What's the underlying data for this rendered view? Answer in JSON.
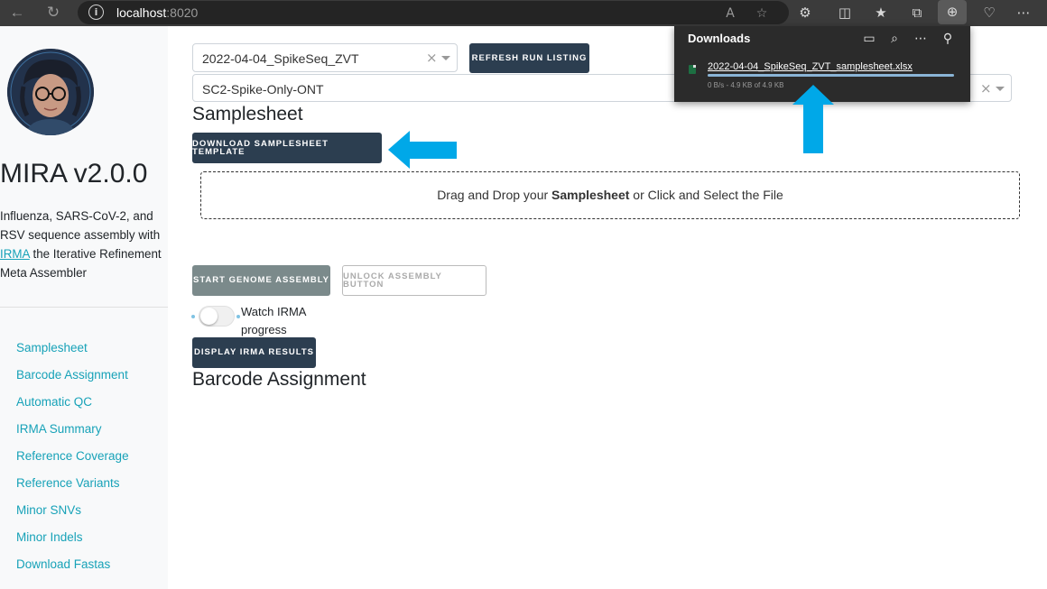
{
  "browser": {
    "url_host": "localhost",
    "url_port": ":8020"
  },
  "sidebar": {
    "app_title": "MIRA v2.0.0",
    "description_pre": "Influenza, SARS-CoV-2, and RSV sequence assembly with ",
    "description_link": "IRMA",
    "description_post": " the Iterative Refinement Meta Assembler",
    "nav": [
      "Samplesheet",
      "Barcode Assignment",
      "Automatic QC",
      "IRMA Summary",
      "Reference Coverage",
      "Reference Variants",
      "Minor SNVs",
      "Minor Indels",
      "Download Fastas"
    ]
  },
  "main": {
    "run_select_value": "2022-04-04_SpikeSeq_ZVT",
    "refresh_button": "REFRESH RUN LISTING",
    "experiment_select_value": "SC2-Spike-Only-ONT",
    "samplesheet_heading": "Samplesheet",
    "download_template_button": "DOWNLOAD SAMPLESHEET TEMPLATE",
    "dropzone_pre": "Drag and Drop your ",
    "dropzone_bold": "Samplesheet",
    "dropzone_post": " or Click and Select the File",
    "start_assembly_button": "START GENOME ASSEMBLY",
    "unlock_button": "UNLOCK ASSEMBLY BUTTON",
    "watch_toggle_label": "Watch IRMA progress",
    "watch_toggle_on": false,
    "display_results_button": "DISPLAY IRMA RESULTS",
    "barcode_heading": "Barcode Assignment",
    "clear_glyph": "×"
  },
  "downloads": {
    "title": "Downloads",
    "file_name": "2022-04-04_SpikeSeq_ZVT_samplesheet.xlsx",
    "status": "0 B/s - 4.9 KB of 4.9 KB",
    "progress": 1.0
  },
  "colors": {
    "accent_link": "#17a2b8",
    "dark_button": "#2c3e50",
    "annotation_arrow": "#00a8e8"
  }
}
